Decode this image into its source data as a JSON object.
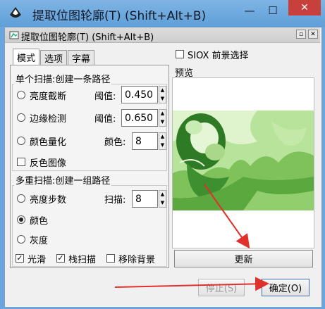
{
  "window": {
    "title": "提取位图轮廓(T) (Shift+Alt+B)",
    "minimize": "—",
    "maximize": "☐",
    "close": "✕"
  },
  "dock": {
    "title": "提取位图轮廓(T) (Shift+Alt+B)"
  },
  "tabs": [
    {
      "label": "模式",
      "active": true
    },
    {
      "label": "选项",
      "active": false
    },
    {
      "label": "字幕",
      "active": false
    }
  ],
  "single_scan": {
    "title": "单个扫描:创建一条路径",
    "brightness": {
      "label": "亮度截断",
      "param_label": "阈值:",
      "value": "0.450",
      "selected": false
    },
    "edge": {
      "label": "边缘检测",
      "param_label": "阈值:",
      "value": "0.650",
      "selected": false
    },
    "color_quant": {
      "label": "颜色量化",
      "param_label": "颜色:",
      "value": "8",
      "selected": false
    },
    "invert": {
      "label": "反色图像",
      "checked": false
    }
  },
  "multi_scan": {
    "title": "多重扫描:创建一组路径",
    "brightness_steps": {
      "label": "亮度步数",
      "param_label": "扫描:",
      "value": "8",
      "selected": false
    },
    "color": {
      "label": "颜色",
      "selected": true
    },
    "gray": {
      "label": "灰度",
      "selected": false
    },
    "smooth": {
      "label": "光滑",
      "checked": true
    },
    "stack": {
      "label": "栈扫描",
      "checked": true
    },
    "remove_bg": {
      "label": "移除背景",
      "checked": false
    }
  },
  "siox": {
    "label": "SIOX 前景选择",
    "checked": false
  },
  "preview": {
    "label": "预览"
  },
  "buttons": {
    "update": "更新",
    "stop": "停止(S)",
    "ok": "确定(O)"
  },
  "colors": {
    "accent_arrow": "#e0302c",
    "title_bar": "#6aa6dd",
    "close_red": "#c8403c"
  }
}
